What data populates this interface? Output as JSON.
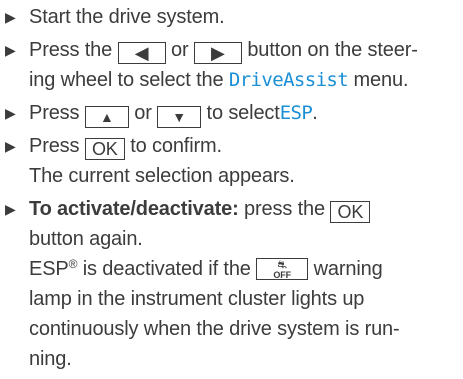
{
  "steps": [
    {
      "line1": "Start the drive system."
    },
    {
      "line1_a": "Press the",
      "left_key": "◀",
      "line1_b": "or",
      "right_key": "▶",
      "line1_c": "button on the steer-",
      "line2_a": "ing wheel to select the",
      "menu": "DriveAssist",
      "line2_b": "menu."
    },
    {
      "a": "Press",
      "up_key": "▲",
      "b": "or",
      "down_key": "▼",
      "c": "to select",
      "menu": "ESP",
      "d": "."
    },
    {
      "a": "Press",
      "ok_key": "OK",
      "b": "to confirm.",
      "line2": "The current selection appears."
    },
    {
      "bold": "To activate/deactivate:",
      "a": "press the",
      "ok_key": "OK",
      "line2": "button again.",
      "line3_a": "ESP",
      "line3_sup": "®",
      "line3_b": "is deactivated if the",
      "lamp_text": "OFF",
      "lamp_icon": "esp-off-warning-lamp-icon",
      "line3_c": "warning",
      "line4": "lamp in the instrument cluster lights up",
      "line5": "continuously when the drive system is run-",
      "line6": "ning."
    }
  ],
  "colors": {
    "text": "#3c3c3c",
    "menu_term": "#1a8fd6"
  }
}
